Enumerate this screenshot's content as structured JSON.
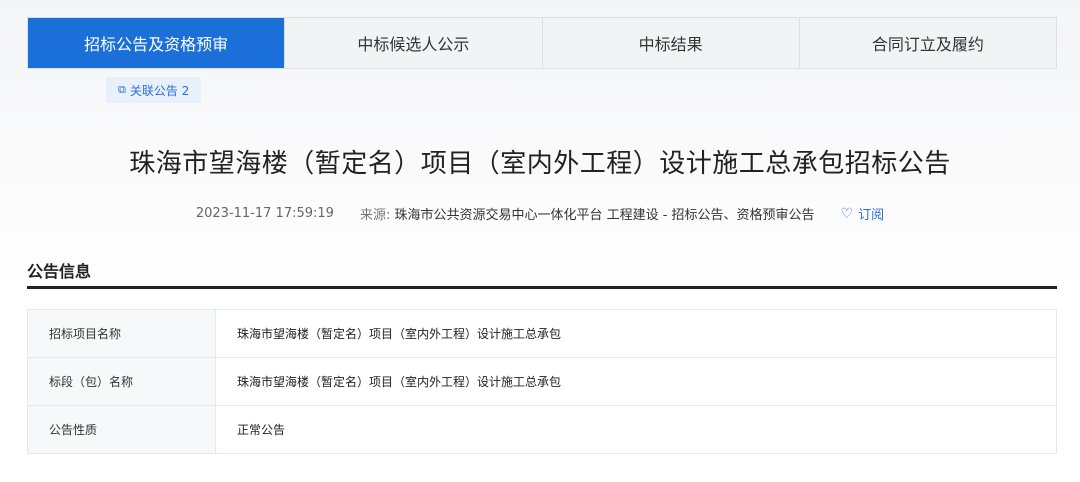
{
  "tabs": [
    {
      "label": "招标公告及资格预审",
      "active": true
    },
    {
      "label": "中标候选人公示",
      "active": false
    },
    {
      "label": "中标结果",
      "active": false
    },
    {
      "label": "合同订立及履约",
      "active": false
    }
  ],
  "related": {
    "icon": "copy-icon",
    "label": "关联公告 2"
  },
  "title": "珠海市望海楼（暂定名）项目（室内外工程）设计施工总承包招标公告",
  "meta": {
    "datetime": "2023-11-17 17:59:19",
    "source_label": "来源:",
    "source": "珠海市公共资源交易中心一体化平台 工程建设 - 招标公告、资格预审公告",
    "subscribe_icon": "heart-icon",
    "subscribe_label": "订阅"
  },
  "section": {
    "title": "公告信息"
  },
  "info_rows": [
    {
      "label": "招标项目名称",
      "value": "珠海市望海楼（暂定名）项目（室内外工程）设计施工总承包"
    },
    {
      "label": "标段（包）名称",
      "value": "珠海市望海楼（暂定名）项目（室内外工程）设计施工总承包"
    },
    {
      "label": "公告性质",
      "value": "正常公告"
    }
  ],
  "colors": {
    "accent": "#1a6fd9",
    "link": "#2f6bd6"
  }
}
